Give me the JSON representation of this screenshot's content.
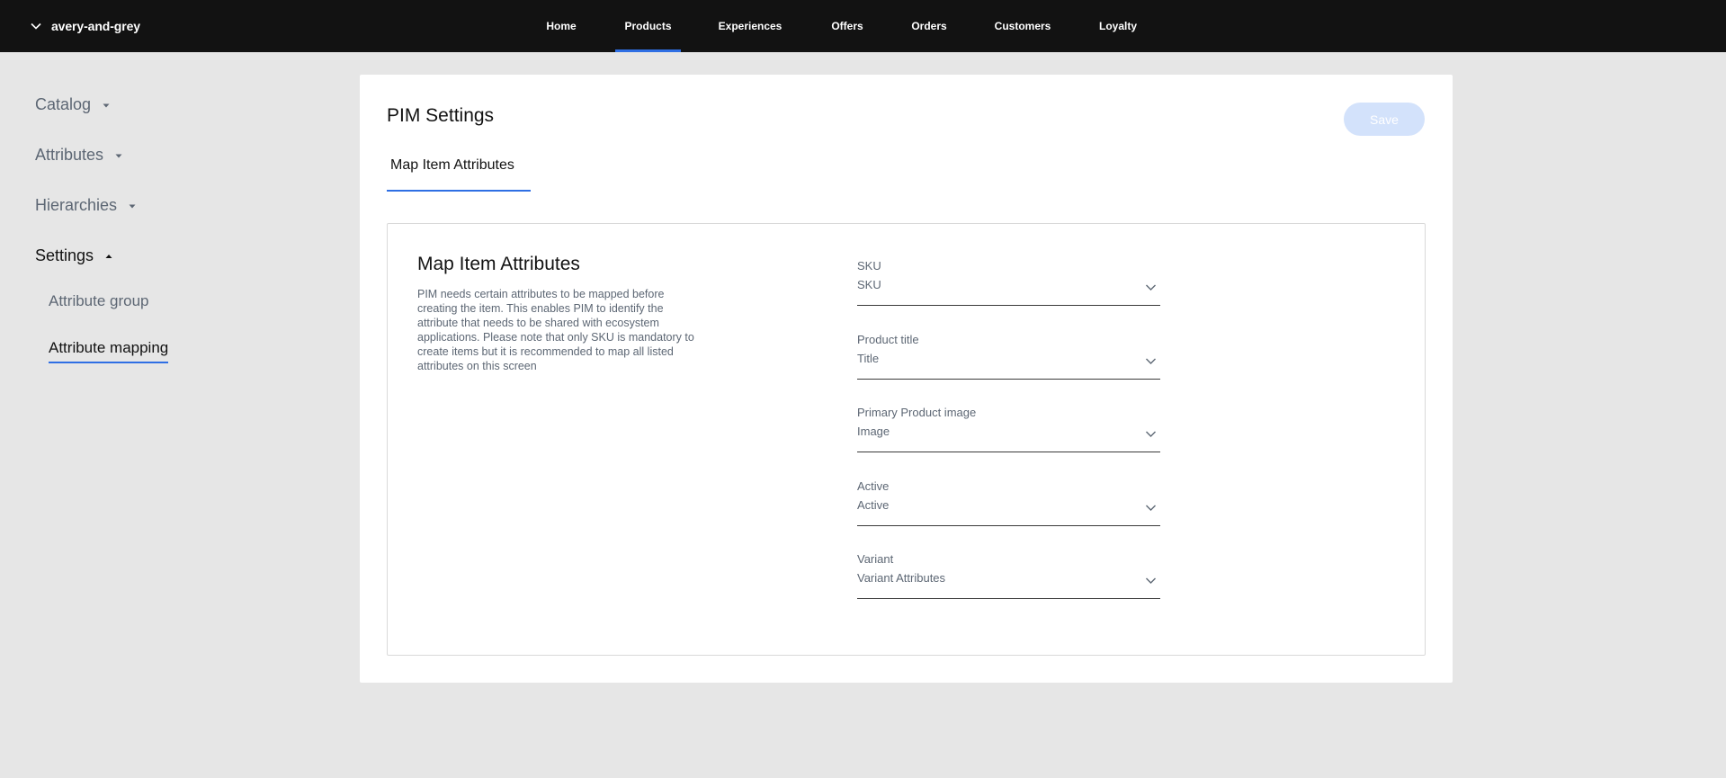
{
  "header": {
    "org_name": "avery-and-grey",
    "org_icon": "chevron-down-icon",
    "nav": [
      {
        "label": "Home",
        "active": false
      },
      {
        "label": "Products",
        "active": true
      },
      {
        "label": "Experiences",
        "active": false
      },
      {
        "label": "Offers",
        "active": false
      },
      {
        "label": "Orders",
        "active": false
      },
      {
        "label": "Customers",
        "active": false
      },
      {
        "label": "Loyalty",
        "active": false
      }
    ]
  },
  "sidebar": {
    "groups": [
      {
        "label": "Catalog",
        "expanded": false
      },
      {
        "label": "Attributes",
        "expanded": false
      },
      {
        "label": "Hierarchies",
        "expanded": false
      },
      {
        "label": "Settings",
        "expanded": true
      }
    ],
    "sub_items": [
      {
        "label": "Attribute group",
        "active": false
      },
      {
        "label": "Attribute mapping",
        "active": true
      }
    ]
  },
  "main": {
    "title": "PIM Settings",
    "save_label": "Save",
    "tab_label": "Map Item Attributes",
    "panel": {
      "title": "Map Item Attributes",
      "description_lines": [
        "PIM needs certain attributes to be mapped before",
        "creating the item. This enables PIM to identify the",
        "attribute that needs to be shared with ecosystem",
        "applications. Please note that only SKU is mandatory to",
        "create items but it is recommended to map all listed",
        "attributes on this screen"
      ],
      "fields": [
        {
          "label": "SKU",
          "value": "SKU"
        },
        {
          "label": "Product title",
          "value": "Title"
        },
        {
          "label": "Primary Product image",
          "value": "Image"
        },
        {
          "label": "Active",
          "value": "Active"
        },
        {
          "label": "Variant",
          "value": "Variant Attributes"
        }
      ]
    }
  },
  "colors": {
    "topbar": "#121212",
    "accent": "#2f6fe4",
    "save_disabled": "#d3e2fb",
    "background": "#e6e6e6"
  }
}
